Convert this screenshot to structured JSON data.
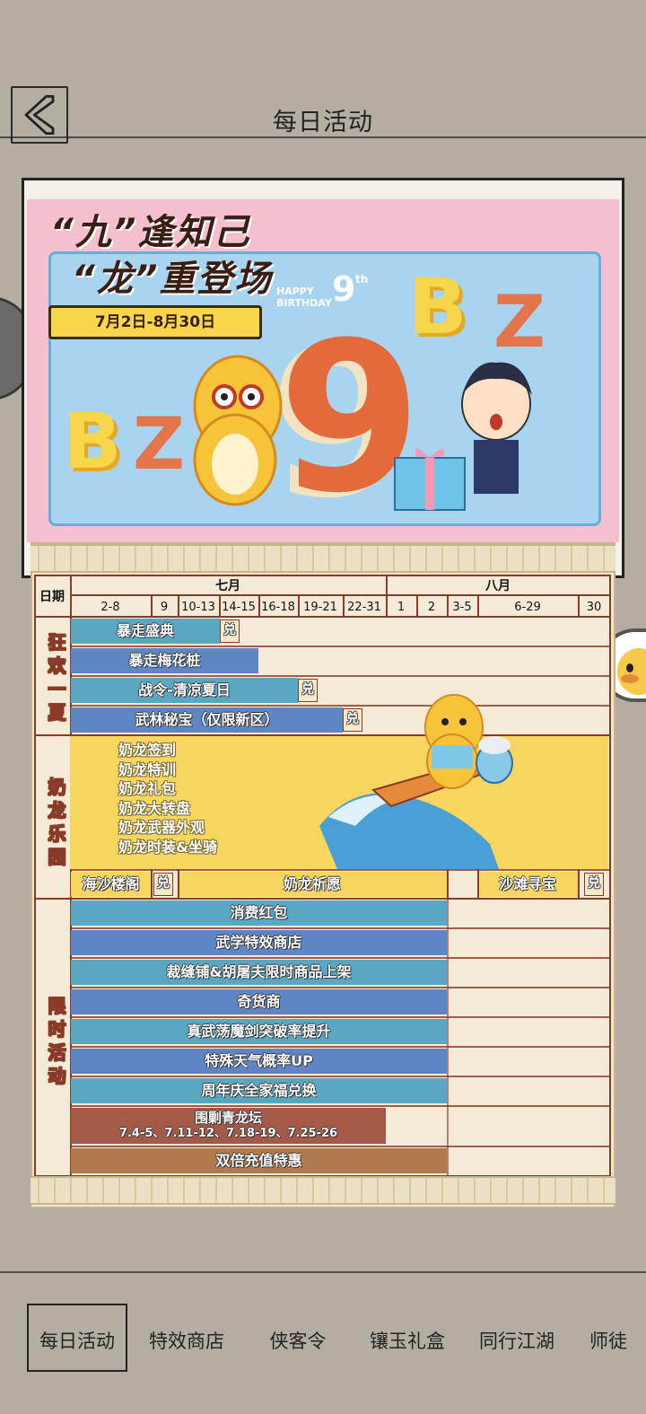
{
  "header": {
    "title": "每日活动"
  },
  "banner": {
    "title_line1": "“九”逢知己",
    "title_line2": "“龙”重登场",
    "date_range": "7月2日-8月30日",
    "happy_birthday": "HAPPY BIRTHDAY",
    "birthday_number": "9",
    "birthday_suffix": "th",
    "big_number": "9",
    "letters": [
      "B",
      "Z",
      "B",
      "Z"
    ]
  },
  "schedule": {
    "date_label": "日期",
    "months": [
      "七月",
      "八月"
    ],
    "columns": [
      "2-8",
      "9",
      "10-13",
      "14-15",
      "16-18",
      "19-21",
      "22-31",
      "1",
      "2",
      "3-5",
      "6-29",
      "30"
    ],
    "redeem_label": "兑",
    "sections": [
      {
        "label": "狂欢一夏"
      },
      {
        "label": "奶龙乐园"
      },
      {
        "label": "限时活动"
      }
    ],
    "kuanghuan": [
      "暴走盛典",
      "暴走梅花桩",
      "战令-清凉夏日",
      "武林秘宝（仅限新区）"
    ],
    "nailong_list": [
      "奶龙签到",
      "奶龙特训",
      "奶龙礼包",
      "奶龙大转盘",
      "奶龙武器外观",
      "奶龙时装&坐骑"
    ],
    "nailong_row": [
      "海沙楼阁",
      "奶龙祈愿",
      "沙滩寻宝"
    ],
    "limited": [
      "消费红包",
      "武学特效商店",
      "裁缝铺&胡屠夫限时商品上架",
      "奇货商",
      "真武荡魔剑突破率提升",
      "特殊天气概率UP",
      "周年庆全家福兑换"
    ],
    "qinglong_title": "围剿青龙坛",
    "qinglong_dates": "7.4-5、7.11-12、7.18-19、7.25-26",
    "double_recharge": "双倍充值特惠"
  },
  "nav": {
    "items": [
      "每日活动",
      "特效商店",
      "侠客令",
      "镶玉礼盒",
      "同行江湖",
      "师徒"
    ],
    "active_index": 0
  },
  "colors": {
    "background": "#b3aea1",
    "teal_bar": "#5aa7c3",
    "blue_bar": "#5f86c4",
    "red_bar": "#a55a48",
    "brown_bar": "#b07a4e",
    "yellow_zone": "#f6d65f",
    "grid_line": "#8a3a28"
  },
  "icons": [
    "back-arrow-icon",
    "duck-mascot-icon"
  ]
}
